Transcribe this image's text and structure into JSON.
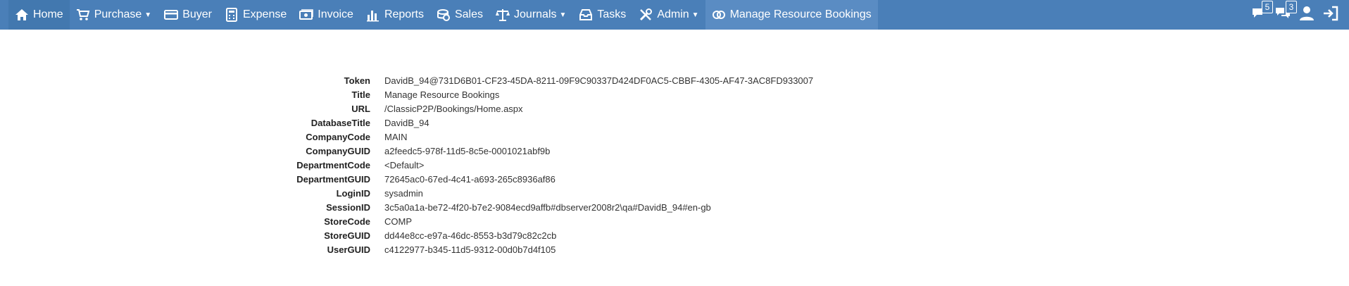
{
  "nav": {
    "items": [
      {
        "label": "Home",
        "icon": "home-icon",
        "caret": false
      },
      {
        "label": "Purchase",
        "icon": "cart-icon",
        "caret": true
      },
      {
        "label": "Buyer",
        "icon": "credit-card-icon",
        "caret": false
      },
      {
        "label": "Expense",
        "icon": "calculator-icon",
        "caret": false
      },
      {
        "label": "Invoice",
        "icon": "money-icon",
        "caret": false
      },
      {
        "label": "Reports",
        "icon": "bar-chart-icon",
        "caret": false
      },
      {
        "label": "Sales",
        "icon": "coins-icon",
        "caret": false
      },
      {
        "label": "Journals",
        "icon": "scales-icon",
        "caret": true
      },
      {
        "label": "Tasks",
        "icon": "inbox-icon",
        "caret": false
      },
      {
        "label": "Admin",
        "icon": "tools-icon",
        "caret": true
      },
      {
        "label": "Manage Resource Bookings",
        "icon": "link-icon",
        "caret": false
      }
    ],
    "caret_glyph": "▼",
    "right": {
      "messages_badge": "5",
      "notifications_badge": "3"
    }
  },
  "info": {
    "rows": [
      {
        "key": "Token",
        "value": "DavidB_94@731D6B01-CF23-45DA-8211-09F9C90337D424DF0AC5-CBBF-4305-AF47-3AC8FD933007"
      },
      {
        "key": "Title",
        "value": "Manage Resource Bookings"
      },
      {
        "key": "URL",
        "value": "/ClassicP2P/Bookings/Home.aspx"
      },
      {
        "key": "DatabaseTitle",
        "value": "DavidB_94"
      },
      {
        "key": "CompanyCode",
        "value": "MAIN"
      },
      {
        "key": "CompanyGUID",
        "value": "a2feedc5-978f-11d5-8c5e-0001021abf9b"
      },
      {
        "key": "DepartmentCode",
        "value": "<Default>"
      },
      {
        "key": "DepartmentGUID",
        "value": "72645ac0-67ed-4c41-a693-265c8936af86"
      },
      {
        "key": "LoginID",
        "value": "sysadmin"
      },
      {
        "key": "SessionID",
        "value": "3c5a0a1a-be72-4f20-b7e2-9084ecd9affb#dbserver2008r2\\qa#DavidB_94#en-gb"
      },
      {
        "key": "StoreCode",
        "value": "COMP"
      },
      {
        "key": "StoreGUID",
        "value": "dd44e8cc-e97a-46dc-8553-b3d79c82c2cb"
      },
      {
        "key": "UserGUID",
        "value": "c4122977-b345-11d5-9312-00d0b7d4f105"
      }
    ]
  }
}
